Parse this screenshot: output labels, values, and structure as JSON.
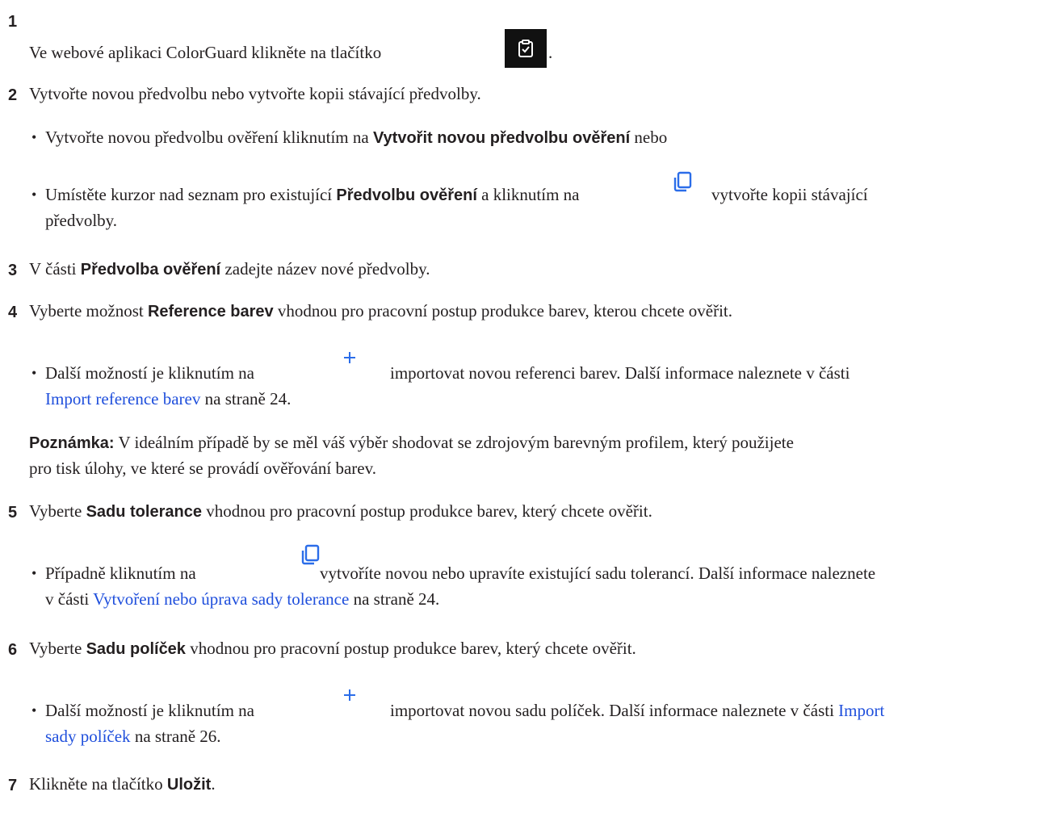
{
  "steps": {
    "s1": {
      "num": "1",
      "text": "Ve webové aplikaci ColorGuard klikněte na tlačítko",
      "end": "."
    },
    "s2": {
      "num": "2",
      "text": "Vytvořte novou předvolbu nebo vytvořte kopii stávající předvolby."
    },
    "s2a": {
      "t1": "Vytvořte novou předvolbu ověření kliknutím na ",
      "b1": "Vytvořit novou předvolbu ověření",
      "t2": " nebo"
    },
    "s2b": {
      "t1": "Umístěte kurzor nad seznam pro existující ",
      "b1": "Předvolbu ověření",
      "t2": " a kliknutím na",
      "t3": "vytvořte kopii stávající",
      "line2": "předvolby."
    },
    "s3": {
      "num": "3",
      "t1": "V části ",
      "b1": "Předvolba ověření",
      "t2": " zadejte název nové předvolby."
    },
    "s4": {
      "num": "4",
      "t1": "Vyberte možnost ",
      "b1": "Reference barev",
      "t2": " vhodnou pro pracovní postup produkce barev, kterou chcete ověřit."
    },
    "s4a": {
      "t1": "Další možností je kliknutím na",
      "t2": "importovat novou referenci barev. Další informace naleznete v části",
      "link": "Import reference barev",
      "t3": " na straně 24."
    },
    "note": {
      "label": "Poznámka:",
      "t1": " V ideálním případě by se měl váš výběr shodovat se zdrojovým barevným profilem, který použijete",
      "line2": "pro tisk úlohy, ve které se provádí ověřování barev."
    },
    "s5": {
      "num": "5",
      "t1": "Vyberte ",
      "b1": "Sadu tolerance",
      "t2": " vhodnou pro pracovní postup produkce barev, který chcete ověřit."
    },
    "s5a": {
      "t1": "Případně kliknutím na",
      "t2": "vytvoříte novou nebo upravíte existující sadu tolerancí. Další informace naleznete",
      "l2pre": "v části ",
      "link": "Vytvoření nebo úprava sady tolerance",
      "t3": " na straně 24."
    },
    "s6": {
      "num": "6",
      "t1": "Vyberte ",
      "b1": "Sadu políček",
      "t2": " vhodnou pro pracovní postup produkce barev, který chcete ověřit."
    },
    "s6a": {
      "t1": "Další možností je kliknutím na",
      "t2": "importovat novou sadu políček. Další informace naleznete v části ",
      "link1": "Import",
      "link2": "sady políček",
      "t3": " na straně 26."
    },
    "s7": {
      "num": "7",
      "t1": "Klikněte na tlačítko ",
      "b1": "Uložit",
      "t2": "."
    }
  },
  "icons": [
    "verify-preset-icon",
    "copy-icon",
    "plus-icon"
  ],
  "colors": {
    "text": "#231f20",
    "link": "#1f4fdc",
    "icon_blue": "#2b6de9",
    "icon_box": "#111111"
  }
}
